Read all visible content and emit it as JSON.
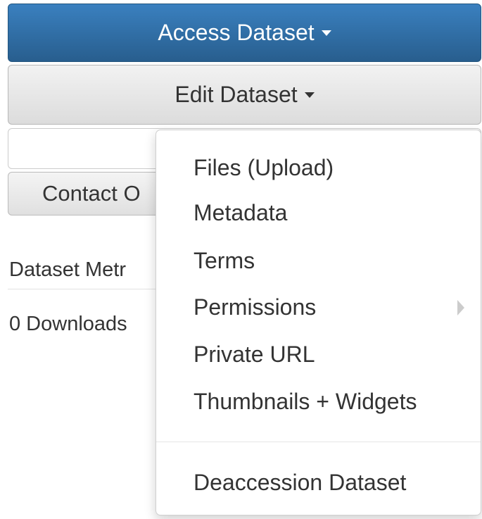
{
  "buttons": {
    "access_dataset": "Access Dataset",
    "edit_dataset": "Edit Dataset",
    "contact": "Contact O"
  },
  "metrics": {
    "title": "Dataset Metr",
    "downloads": "0 Downloads"
  },
  "edit_menu": {
    "items": [
      "Files (Upload)",
      "Metadata",
      "Terms",
      "Permissions",
      "Private URL",
      "Thumbnails + Widgets",
      "Deaccession Dataset"
    ],
    "submenu_icon": "chevron-right-icon"
  },
  "colors": {
    "primary_button": "#2f6fa8",
    "default_button": "#e6e6e6",
    "text": "#333333"
  }
}
